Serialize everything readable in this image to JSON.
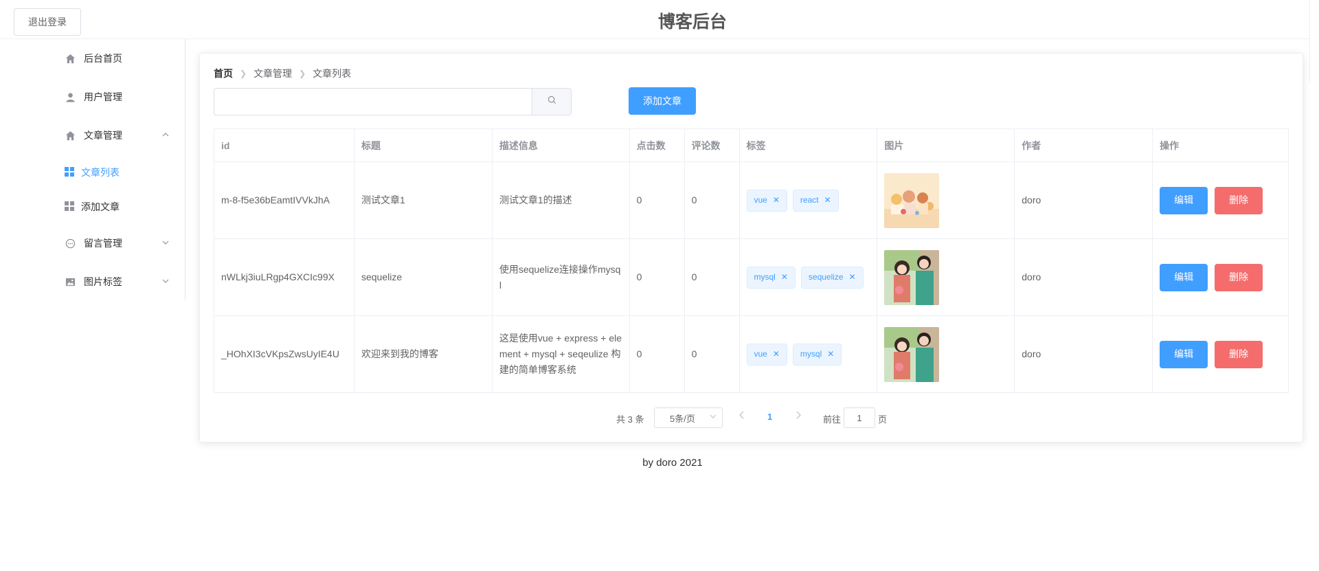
{
  "header": {
    "logout_label": "退出登录",
    "title": "博客后台"
  },
  "sidebar": {
    "items": [
      {
        "label": "后台首页",
        "icon": "home-icon"
      },
      {
        "label": "用户管理",
        "icon": "user-icon"
      },
      {
        "label": "文章管理",
        "icon": "home-icon",
        "expanded": true,
        "children": [
          {
            "label": "文章列表",
            "icon": "grid-icon",
            "active": true
          },
          {
            "label": "添加文章",
            "icon": "grid-icon"
          }
        ]
      },
      {
        "label": "留言管理",
        "icon": "chat-icon"
      },
      {
        "label": "图片标签",
        "icon": "picture-icon"
      }
    ]
  },
  "breadcrumb": [
    "首页",
    "文章管理",
    "文章列表"
  ],
  "search": {
    "value": "",
    "placeholder": ""
  },
  "add_button_label": "添加文章",
  "table": {
    "headers": [
      "id",
      "标题",
      "描述信息",
      "点击数",
      "评论数",
      "标签",
      "图片",
      "作者",
      "操作"
    ],
    "rows": [
      {
        "id": "m-8-f5e36bEamtIVVkJhA",
        "title": "测试文章1",
        "desc": "测试文章1的描述",
        "clicks": "0",
        "comments": "0",
        "tags": [
          "vue",
          "react"
        ],
        "image": "cover-image-1",
        "author": "doro"
      },
      {
        "id": "nWLkj3iuLRgp4GXCIc99X",
        "title": "sequelize",
        "desc": "使用sequelize连接操作mysql",
        "clicks": "0",
        "comments": "0",
        "tags": [
          "mysql",
          "sequelize"
        ],
        "image": "cover-image-2",
        "author": "doro"
      },
      {
        "id": "_HOhXI3cVKpsZwsUyIE4U",
        "title": "欢迎来到我的博客",
        "desc": "这是使用vue + express + element + mysql + seqeulize 构建的简单博客系统",
        "clicks": "0",
        "comments": "0",
        "tags": [
          "vue",
          "mysql"
        ],
        "image": "cover-image-2",
        "author": "doro"
      }
    ],
    "edit_label": "编辑",
    "delete_label": "删除"
  },
  "pagination": {
    "total_text": "共 3 条",
    "page_size": "5条/页",
    "current_page": "1",
    "goto_label": "前往",
    "goto_value": "1",
    "page_suffix": "页"
  },
  "footer": "by doro 2021",
  "colors": {
    "primary": "#409eff",
    "danger": "#f56c6c",
    "tag_bg": "#ecf5ff"
  }
}
